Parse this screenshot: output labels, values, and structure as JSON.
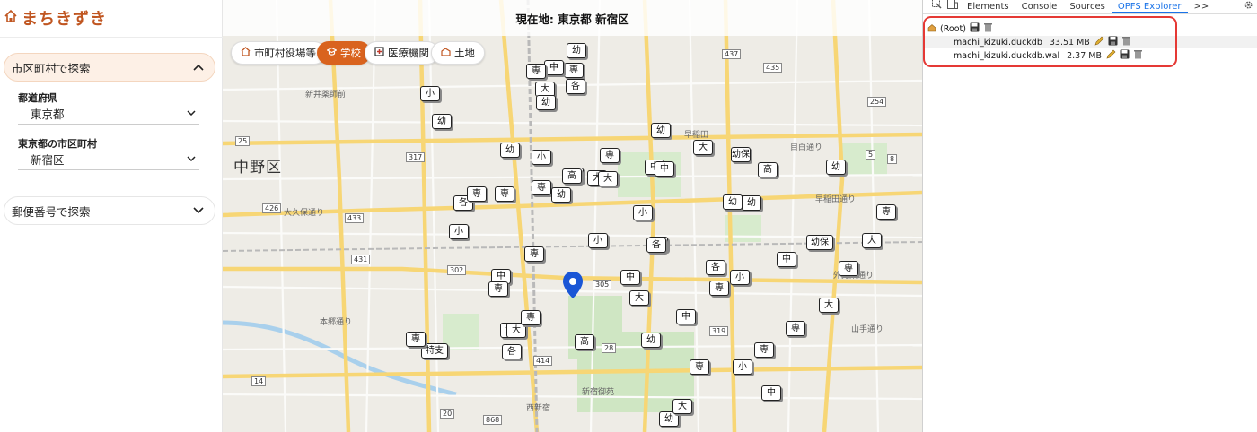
{
  "brand": {
    "name": "まちきずき"
  },
  "sidebar": {
    "city_section": {
      "label": "市区町村で探索",
      "prefecture_label": "都道府県",
      "prefecture_value": "東京都",
      "city_label": "東京都の市区町村",
      "city_value": "新宿区"
    },
    "zip_section": {
      "label": "郵便番号で探索"
    }
  },
  "map": {
    "title": "現在地: 東京都 新宿区",
    "filters": [
      {
        "label": "市町村役場等",
        "icon": "city-hall-icon",
        "active": false
      },
      {
        "label": "学校",
        "icon": "school-icon",
        "active": true
      },
      {
        "label": "医療機関",
        "icon": "hospital-icon",
        "active": false
      },
      {
        "label": "土地",
        "icon": "land-icon",
        "active": false
      }
    ],
    "ward_label": "中野区",
    "places": [
      "新井薬師前",
      "大久保通り",
      "早稲田",
      "目白通り",
      "本郷通り",
      "新宿御苑",
      "西新宿",
      "山手通り",
      "外苑東通り",
      "早稲田通り"
    ],
    "routes": [
      "25",
      "317",
      "433",
      "302",
      "305",
      "319",
      "414",
      "20",
      "28",
      "14",
      "431",
      "254",
      "435",
      "437",
      "426",
      "868",
      "5",
      "8"
    ],
    "markers": [
      "幼",
      "専",
      "大",
      "小",
      "各",
      "中",
      "高",
      "専",
      "幼",
      "小",
      "専",
      "各",
      "高",
      "中",
      "大",
      "幼",
      "専",
      "小",
      "中",
      "大",
      "各",
      "幼保",
      "特支",
      "専",
      "幼",
      "高",
      "中",
      "専",
      "大",
      "小",
      "幼",
      "専",
      "幼",
      "各",
      "中",
      "大",
      "専",
      "小",
      "専",
      "幼",
      "中",
      "専",
      "高",
      "幼",
      "大",
      "専",
      "各",
      "小",
      "中",
      "幼",
      "専",
      "大",
      "幼保",
      "専",
      "大",
      "専",
      "幼",
      "大",
      "専",
      "小",
      "中",
      "各",
      "幼",
      "大",
      "専",
      "小"
    ],
    "accent": "#d9631e"
  },
  "devtools": {
    "tabs": [
      "Elements",
      "Console",
      "Sources",
      "OPFS Explorer"
    ],
    "active_tab": "OPFS Explorer",
    "more": ">>",
    "root_label": "(Root)",
    "files": [
      {
        "name": "machi_kizuki.duckdb",
        "size": "33.51 MB"
      },
      {
        "name": "machi_kizuki.duckdb.wal",
        "size": "2.37 MB"
      }
    ],
    "highlight_color": "#e53935"
  }
}
